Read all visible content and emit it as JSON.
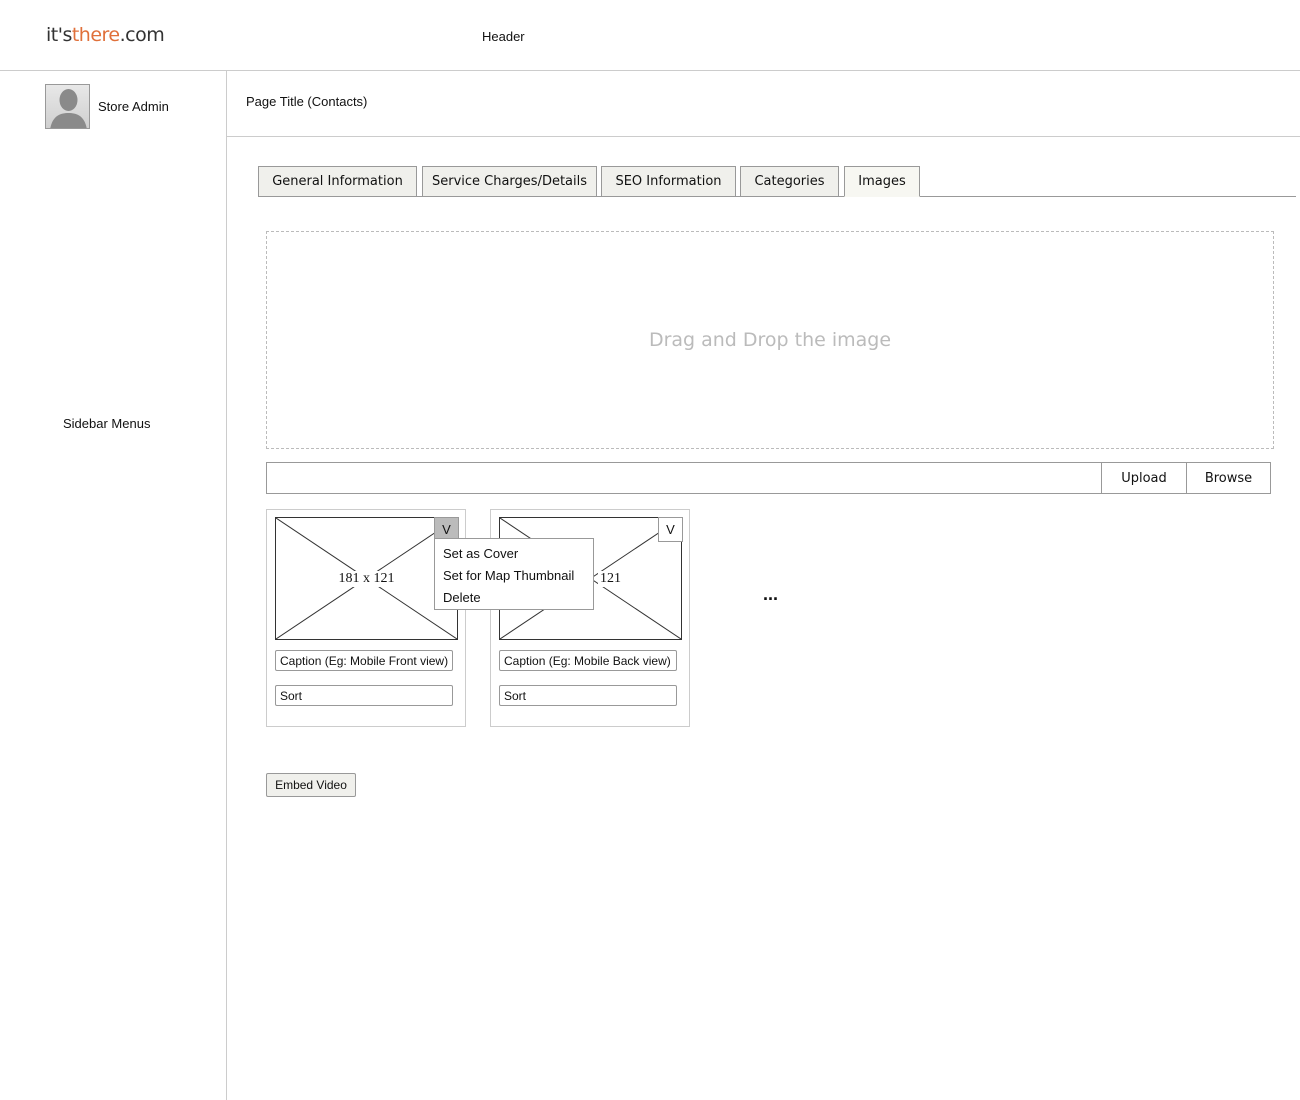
{
  "header": {
    "logo": {
      "part1": "it's",
      "part2": "there",
      "part3": ".com"
    },
    "label": "Header"
  },
  "sidebar": {
    "user_name": "Store Admin",
    "menus_label": "Sidebar Menus"
  },
  "page": {
    "title": "Page Title (Contacts)"
  },
  "tabs": [
    {
      "label": "General Information",
      "active": false
    },
    {
      "label": "Service Charges/Details",
      "active": false
    },
    {
      "label": "SEO Information",
      "active": false
    },
    {
      "label": "Categories",
      "active": false
    },
    {
      "label": "Images",
      "active": true
    }
  ],
  "dropzone": {
    "text": "Drag and Drop the image"
  },
  "upload": {
    "input_value": "",
    "upload_label": "Upload",
    "browse_label": "Browse"
  },
  "images": [
    {
      "dims": "181 x 121",
      "toggle": "V",
      "caption": "Caption (Eg: Mobile Front view)",
      "sort": "Sort"
    },
    {
      "dims": "121",
      "toggle": "V",
      "caption": "Caption (Eg: Mobile Back view)",
      "sort": "Sort"
    }
  ],
  "menu": {
    "items": [
      "Set as Cover",
      "Set for Map Thumbnail",
      "Delete"
    ]
  },
  "more": "...",
  "embed_video_label": "Embed Video"
}
